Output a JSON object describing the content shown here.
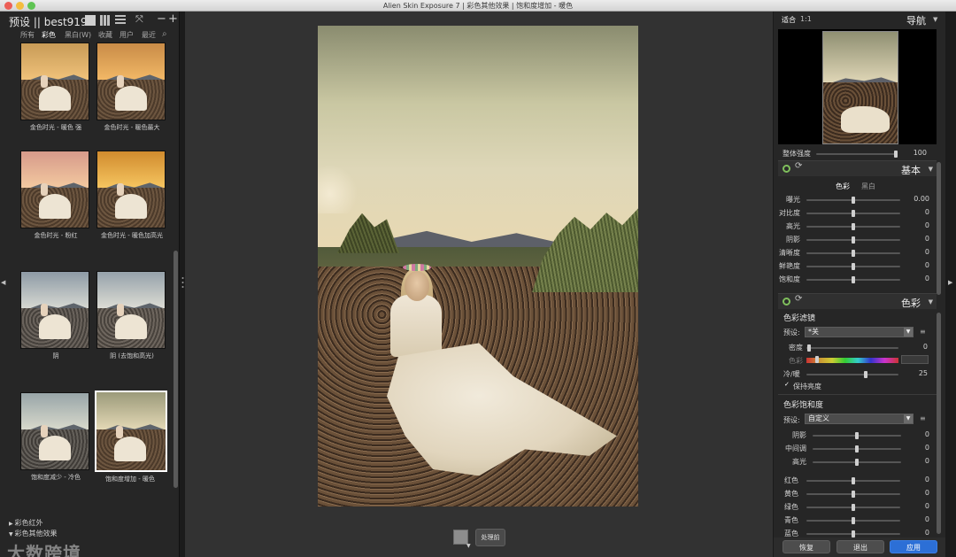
{
  "window": {
    "title": "Alien Skin Exposure 7 | 彩色其他效果 | 饱和度增加 - 暖色"
  },
  "left_panel": {
    "title": "预设 || best919",
    "categories": [
      "所有",
      "彩色",
      "黑白(W)",
      "收藏",
      "用户",
      "最近"
    ],
    "active_category": "彩色",
    "presets": [
      {
        "label": "金色时光 - 暖色 强",
        "selected": false
      },
      {
        "label": "金色时光 - 暖色最大",
        "selected": false
      },
      {
        "label": "金色时光 - 粉红",
        "selected": false
      },
      {
        "label": "金色时光 - 暖色加高光",
        "selected": false
      },
      {
        "label": "阴",
        "selected": false
      },
      {
        "label": "阴 (去饱和高光)",
        "selected": false
      },
      {
        "label": "饱和度减少 - 冷色",
        "selected": false
      },
      {
        "label": "饱和度增加 - 暖色",
        "selected": true
      }
    ],
    "groups": [
      "彩色红外",
      "彩色其他效果"
    ],
    "watermark": "大数跨境"
  },
  "center": {
    "process_before_label": "处理前"
  },
  "right_panel": {
    "navigator": {
      "fit_label": "适合",
      "one_to_one_label": "1:1",
      "title": "导航"
    },
    "overall_strength": {
      "label": "整体强度",
      "value": "100"
    },
    "basic": {
      "title": "基本",
      "tabs": [
        "色彩",
        "黑白"
      ],
      "active_tab": "色彩",
      "sliders": [
        {
          "label": "曝光",
          "value": "0.00",
          "position": 0.5
        },
        {
          "label": "对比度",
          "value": "0",
          "position": 0.5
        },
        {
          "label": "高光",
          "value": "0",
          "position": 0.5
        },
        {
          "label": "阴影",
          "value": "0",
          "position": 0.5
        },
        {
          "label": "清晰度",
          "value": "0",
          "position": 0.5
        },
        {
          "label": "鲜艳度",
          "value": "0",
          "position": 0.5
        },
        {
          "label": "饱和度",
          "value": "0",
          "position": 0.5
        }
      ]
    },
    "color": {
      "title": "色彩",
      "color_filter": {
        "title": "色彩滤镜",
        "preset_label": "预设:",
        "preset_value": "*关",
        "density_label": "密度",
        "density_value": "0",
        "hue_label": "色彩",
        "warm_cool_label": "冷/暖",
        "warm_cool_value": "25",
        "keep_brightness_label": "保持亮度",
        "keep_brightness_checked": true
      },
      "color_saturation": {
        "title": "色彩饱和度",
        "preset_label": "预设:",
        "preset_value": "自定义",
        "tone_sliders": [
          {
            "label": "阴影",
            "value": "0",
            "position": 0.5
          },
          {
            "label": "中间调",
            "value": "0",
            "position": 0.5
          },
          {
            "label": "高光",
            "value": "0",
            "position": 0.5
          }
        ],
        "color_sliders": [
          {
            "label": "红色",
            "value": "0",
            "position": 0.5
          },
          {
            "label": "黄色",
            "value": "0",
            "position": 0.5
          },
          {
            "label": "绿色",
            "value": "0",
            "position": 0.5
          },
          {
            "label": "青色",
            "value": "0",
            "position": 0.5
          },
          {
            "label": "蓝色",
            "value": "0",
            "position": 0.5
          }
        ]
      }
    },
    "bottom_buttons": {
      "restore": "恢复",
      "exit": "退出",
      "apply": "应用"
    }
  },
  "colors": {
    "accent": "#2c6fd6",
    "power_on": "#7fbf5c"
  }
}
